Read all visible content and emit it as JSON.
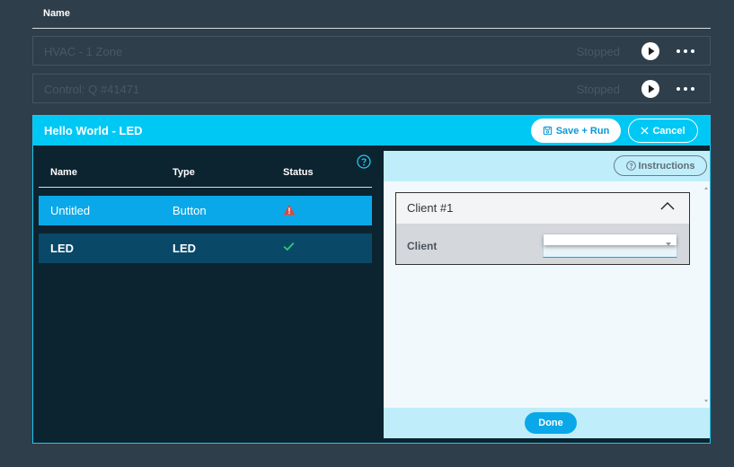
{
  "flows_table": {
    "header_name": "Name",
    "rows": [
      {
        "name": "HVAC - 1 Zone",
        "status": "Stopped"
      },
      {
        "name": "Control: Q #41471",
        "status": "Stopped"
      }
    ]
  },
  "editor": {
    "title": "Hello World - LED",
    "save_label": "Save + Run",
    "cancel_label": "Cancel",
    "devices": {
      "headers": {
        "name": "Name",
        "type": "Type",
        "status": "Status"
      },
      "rows": [
        {
          "name": "Untitled",
          "type": "Button",
          "status_icon": "warning-icon"
        },
        {
          "name": "LED",
          "type": "LED",
          "status_icon": "check-icon"
        }
      ]
    },
    "right_pane": {
      "instructions_label": "Instructions",
      "client_title": "Client #1",
      "client_label": "Client",
      "client_value": "",
      "done_label": "Done"
    }
  },
  "colors": {
    "background": "#2e3e4b",
    "accent": "#00c8f5",
    "selected_row": "#0aa8e8",
    "warning": "#e0463c",
    "success": "#2ecc71"
  }
}
